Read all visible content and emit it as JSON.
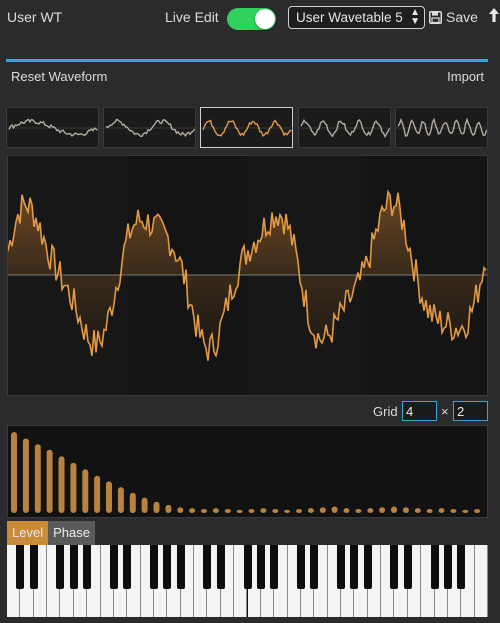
{
  "header": {
    "title": "User WT",
    "live_edit_label": "Live Edit",
    "live_edit_on": true,
    "wavetable_select": "User Wavetable 5",
    "save_label": "Save"
  },
  "toolbar": {
    "reset_label": "Reset Waveform",
    "import_label": "Import"
  },
  "thumbnails": {
    "count": 5,
    "selected_index": 2
  },
  "grid": {
    "label": "Grid",
    "x_value": "4",
    "separator": "×",
    "y_value": "2"
  },
  "tabs": {
    "level_label": "Level",
    "phase_label": "Phase",
    "active": "Level"
  },
  "colors": {
    "accent": "#e39a45",
    "toggle_on": "#2fd15a",
    "divider_blue": "#3ba5d8",
    "thumb_wave": "#b3aca0"
  },
  "icons": {
    "save": "floppy-disk-icon",
    "export": "upload-arrow-icon",
    "select_arrows": "updown-chevron-icon"
  },
  "keyboard": {
    "white_keys": 36
  },
  "harmonics": {
    "levels": [
      1.0,
      0.92,
      0.85,
      0.78,
      0.7,
      0.62,
      0.54,
      0.46,
      0.39,
      0.32,
      0.25,
      0.19,
      0.14,
      0.1,
      0.07,
      0.06,
      0.05,
      0.06,
      0.05,
      0.04,
      0.05,
      0.06,
      0.05,
      0.04,
      0.05,
      0.06,
      0.07,
      0.08,
      0.06,
      0.05,
      0.06,
      0.07,
      0.08,
      0.07,
      0.06,
      0.05,
      0.06,
      0.05,
      0.04,
      0.05
    ]
  }
}
